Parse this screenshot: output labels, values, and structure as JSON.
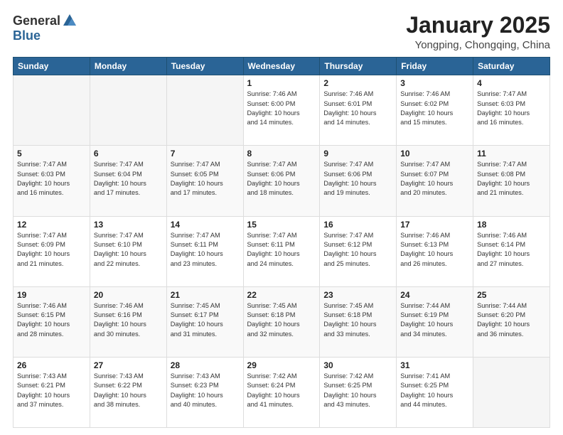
{
  "header": {
    "logo_general": "General",
    "logo_blue": "Blue",
    "month_title": "January 2025",
    "location": "Yongping, Chongqing, China"
  },
  "weekdays": [
    "Sunday",
    "Monday",
    "Tuesday",
    "Wednesday",
    "Thursday",
    "Friday",
    "Saturday"
  ],
  "weeks": [
    [
      {
        "day": "",
        "info": ""
      },
      {
        "day": "",
        "info": ""
      },
      {
        "day": "",
        "info": ""
      },
      {
        "day": "1",
        "info": "Sunrise: 7:46 AM\nSunset: 6:00 PM\nDaylight: 10 hours\nand 14 minutes."
      },
      {
        "day": "2",
        "info": "Sunrise: 7:46 AM\nSunset: 6:01 PM\nDaylight: 10 hours\nand 14 minutes."
      },
      {
        "day": "3",
        "info": "Sunrise: 7:46 AM\nSunset: 6:02 PM\nDaylight: 10 hours\nand 15 minutes."
      },
      {
        "day": "4",
        "info": "Sunrise: 7:47 AM\nSunset: 6:03 PM\nDaylight: 10 hours\nand 16 minutes."
      }
    ],
    [
      {
        "day": "5",
        "info": "Sunrise: 7:47 AM\nSunset: 6:03 PM\nDaylight: 10 hours\nand 16 minutes."
      },
      {
        "day": "6",
        "info": "Sunrise: 7:47 AM\nSunset: 6:04 PM\nDaylight: 10 hours\nand 17 minutes."
      },
      {
        "day": "7",
        "info": "Sunrise: 7:47 AM\nSunset: 6:05 PM\nDaylight: 10 hours\nand 17 minutes."
      },
      {
        "day": "8",
        "info": "Sunrise: 7:47 AM\nSunset: 6:06 PM\nDaylight: 10 hours\nand 18 minutes."
      },
      {
        "day": "9",
        "info": "Sunrise: 7:47 AM\nSunset: 6:06 PM\nDaylight: 10 hours\nand 19 minutes."
      },
      {
        "day": "10",
        "info": "Sunrise: 7:47 AM\nSunset: 6:07 PM\nDaylight: 10 hours\nand 20 minutes."
      },
      {
        "day": "11",
        "info": "Sunrise: 7:47 AM\nSunset: 6:08 PM\nDaylight: 10 hours\nand 21 minutes."
      }
    ],
    [
      {
        "day": "12",
        "info": "Sunrise: 7:47 AM\nSunset: 6:09 PM\nDaylight: 10 hours\nand 21 minutes."
      },
      {
        "day": "13",
        "info": "Sunrise: 7:47 AM\nSunset: 6:10 PM\nDaylight: 10 hours\nand 22 minutes."
      },
      {
        "day": "14",
        "info": "Sunrise: 7:47 AM\nSunset: 6:11 PM\nDaylight: 10 hours\nand 23 minutes."
      },
      {
        "day": "15",
        "info": "Sunrise: 7:47 AM\nSunset: 6:11 PM\nDaylight: 10 hours\nand 24 minutes."
      },
      {
        "day": "16",
        "info": "Sunrise: 7:47 AM\nSunset: 6:12 PM\nDaylight: 10 hours\nand 25 minutes."
      },
      {
        "day": "17",
        "info": "Sunrise: 7:46 AM\nSunset: 6:13 PM\nDaylight: 10 hours\nand 26 minutes."
      },
      {
        "day": "18",
        "info": "Sunrise: 7:46 AM\nSunset: 6:14 PM\nDaylight: 10 hours\nand 27 minutes."
      }
    ],
    [
      {
        "day": "19",
        "info": "Sunrise: 7:46 AM\nSunset: 6:15 PM\nDaylight: 10 hours\nand 28 minutes."
      },
      {
        "day": "20",
        "info": "Sunrise: 7:46 AM\nSunset: 6:16 PM\nDaylight: 10 hours\nand 30 minutes."
      },
      {
        "day": "21",
        "info": "Sunrise: 7:45 AM\nSunset: 6:17 PM\nDaylight: 10 hours\nand 31 minutes."
      },
      {
        "day": "22",
        "info": "Sunrise: 7:45 AM\nSunset: 6:18 PM\nDaylight: 10 hours\nand 32 minutes."
      },
      {
        "day": "23",
        "info": "Sunrise: 7:45 AM\nSunset: 6:18 PM\nDaylight: 10 hours\nand 33 minutes."
      },
      {
        "day": "24",
        "info": "Sunrise: 7:44 AM\nSunset: 6:19 PM\nDaylight: 10 hours\nand 34 minutes."
      },
      {
        "day": "25",
        "info": "Sunrise: 7:44 AM\nSunset: 6:20 PM\nDaylight: 10 hours\nand 36 minutes."
      }
    ],
    [
      {
        "day": "26",
        "info": "Sunrise: 7:43 AM\nSunset: 6:21 PM\nDaylight: 10 hours\nand 37 minutes."
      },
      {
        "day": "27",
        "info": "Sunrise: 7:43 AM\nSunset: 6:22 PM\nDaylight: 10 hours\nand 38 minutes."
      },
      {
        "day": "28",
        "info": "Sunrise: 7:43 AM\nSunset: 6:23 PM\nDaylight: 10 hours\nand 40 minutes."
      },
      {
        "day": "29",
        "info": "Sunrise: 7:42 AM\nSunset: 6:24 PM\nDaylight: 10 hours\nand 41 minutes."
      },
      {
        "day": "30",
        "info": "Sunrise: 7:42 AM\nSunset: 6:25 PM\nDaylight: 10 hours\nand 43 minutes."
      },
      {
        "day": "31",
        "info": "Sunrise: 7:41 AM\nSunset: 6:25 PM\nDaylight: 10 hours\nand 44 minutes."
      },
      {
        "day": "",
        "info": ""
      }
    ]
  ]
}
